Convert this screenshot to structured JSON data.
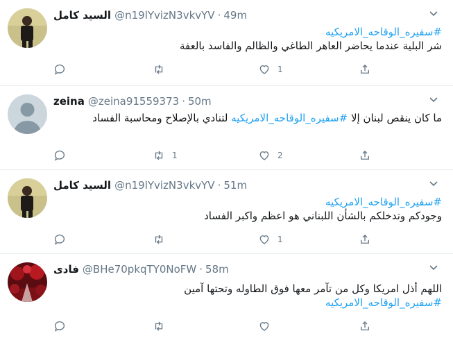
{
  "tweets": [
    {
      "name": "السيد كامل",
      "handle": "@n19lYvizN3vkvYV",
      "time": "49m",
      "hashtag": "#سفيره_الوقاحه_الامريكيه",
      "text": "شر البلية عندما يحاضر العاهر الطاغي والظالم والفاسد بالعفة",
      "hashtag_first": true,
      "counts": {
        "reply": "",
        "retweet": "",
        "like": "1",
        "share": ""
      },
      "avatar": "person-dark"
    },
    {
      "name": "zeina",
      "handle": "@zeina91559373",
      "time": "50m",
      "hashtag": "#سفيره_الوقاحه_الامريكيه",
      "text_before": "ما كان ينقص لبنان إلا",
      "text_after": "لتنادي بالإصلاح ومحاسبة الفساد",
      "inline_hashtag": true,
      "counts": {
        "reply": "",
        "retweet": "1",
        "like": "2",
        "share": ""
      },
      "avatar": "default"
    },
    {
      "name": "السيد كامل",
      "handle": "@n19lYvizN3vkvYV",
      "time": "51m",
      "hashtag": "#سفيره_الوقاحه_الامريكيه",
      "text": "وجودكم وتدخلكم بالشأن اللبناني هو اعظم واكبر الفساد",
      "hashtag_first": true,
      "counts": {
        "reply": "",
        "retweet": "",
        "like": "1",
        "share": ""
      },
      "avatar": "person-dark"
    },
    {
      "name": "فادى",
      "handle": "@BHe70pkqTY0NoFW",
      "time": "58m",
      "hashtag": "#سفيره_الوقاحه_الامريكيه",
      "text": "اللهم أذل امريكا وكل من تآمر معها فوق الطاوله وتحتها آمين",
      "hashtag_first": false,
      "counts": {
        "reply": "",
        "retweet": "",
        "like": "",
        "share": ""
      },
      "avatar": "red-scene"
    }
  ],
  "colors": {
    "accent": "#1da1f2",
    "muted": "#657786",
    "text": "#14171a",
    "border": "#e6ecf0"
  },
  "icons": [
    "reply-icon",
    "retweet-icon",
    "like-icon",
    "share-icon",
    "caret-down-icon"
  ]
}
